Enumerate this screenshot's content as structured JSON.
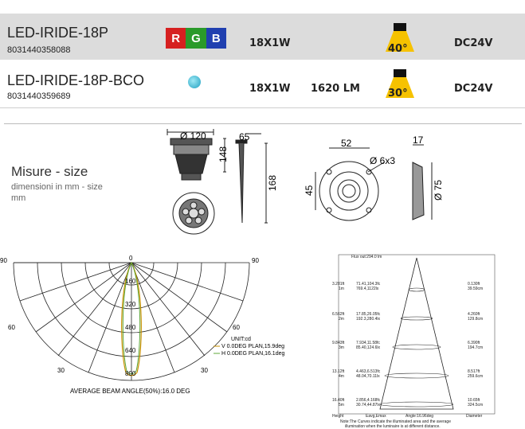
{
  "products": [
    {
      "name": "LED-IRIDE-18P",
      "code": "8031440358088",
      "color_label": [
        "R",
        "G",
        "B"
      ],
      "power": "18X1W",
      "lumen": "",
      "angle": "40°",
      "voltage": "DC24V",
      "angle_color": "#f6c200"
    },
    {
      "name": "LED-IRIDE-18P-BCO",
      "code": "8031440359689",
      "power": "18X1W",
      "lumen": "1620 LM",
      "angle": "30°",
      "voltage": "DC24V",
      "angle_color": "#f6c200"
    }
  ],
  "rgb_colors": [
    "#d62020",
    "#2a9a2a",
    "#2040b0"
  ],
  "size": {
    "title": "Misure - size",
    "subtitle": "dimensioni in mm - size mm"
  },
  "dimensions": {
    "d120": "Ø 120",
    "d65": "65",
    "d148": "148",
    "d168": "168",
    "d52": "52",
    "d6x3": "Ø 6x3",
    "d45": "45",
    "d17": "17",
    "d75": "Ø 75"
  },
  "polar": {
    "angles_top": [
      "90",
      "0",
      "90"
    ],
    "angles_side": [
      "60",
      "60"
    ],
    "angles_bottom": [
      "30",
      "30"
    ],
    "radial": [
      "160",
      "320",
      "480",
      "640",
      "800"
    ],
    "unit": "UNIT:cd",
    "legend": [
      "V 0.0DEG PLAN,15.9deg",
      "H 0.0DEG PLAN,16.1deg"
    ],
    "beam_angle": "AVERAGE BEAM ANGLE(50%):16.0 DEG"
  },
  "illum": {
    "header": "Flux out:294.0 lm",
    "rows": [
      {
        "left": "3.281ft",
        "left2": "1m",
        "mid": "71.41,104.3fc",
        "mid2": "769.4,1122lx",
        "right": "0.130ft",
        "right2": "39.59cm"
      },
      {
        "left": "6.562ft",
        "left2": "2m",
        "mid": "17.85,26.05fc",
        "mid2": "192.3,280.4lx",
        "right": "4.260ft",
        "right2": "129.8cm"
      },
      {
        "left": "9.843ft",
        "left2": "3m",
        "mid": "7.934,11.58fc",
        "mid2": "85.40,124.6lx",
        "right": "6.390ft",
        "right2": "194.7cm"
      },
      {
        "left": "13.12ft",
        "left2": "4m",
        "mid": "4.463,6.513fc",
        "mid2": "48.04,70.11lx",
        "right": "8.517ft",
        "right2": "259.6cm"
      },
      {
        "left": "16.40ft",
        "left2": "5m",
        "mid": "2.856,4.168fc",
        "mid2": "30.74,44.87lx",
        "right": "10.65ft",
        "right2": "324.5cm"
      }
    ],
    "footer": [
      "Height",
      "Eavg,Emax",
      "Angle:16.96deg",
      "Diameter"
    ],
    "note1": "Note:The Curves indicate the illuminated area and the average",
    "note2": "illumination when the luminaire is at different distance."
  }
}
